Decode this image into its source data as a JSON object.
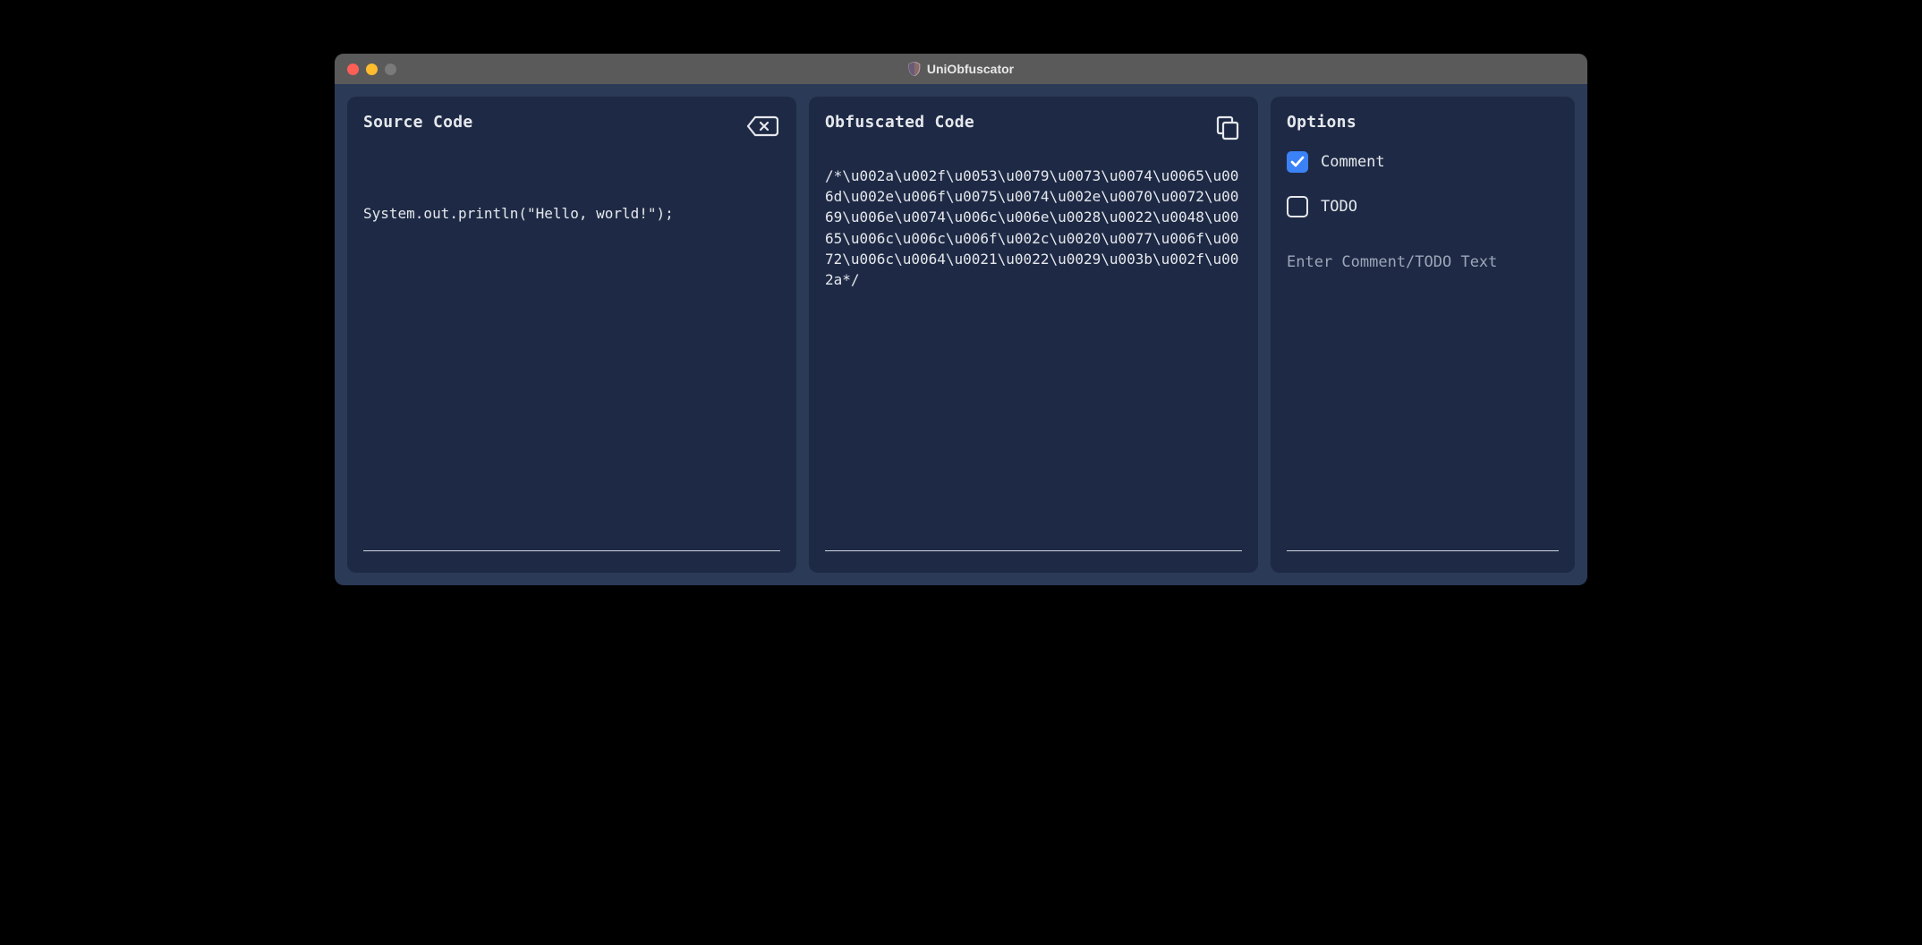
{
  "window": {
    "title": "UniObfuscator"
  },
  "panels": {
    "source": {
      "title": "Source Code",
      "content": "System.out.println(\"Hello, world!\");"
    },
    "obfuscated": {
      "title": "Obfuscated Code",
      "content": "/*\\u002a\\u002f\\u0053\\u0079\\u0073\\u0074\\u0065\\u006d\\u002e\\u006f\\u0075\\u0074\\u002e\\u0070\\u0072\\u0069\\u006e\\u0074\\u006c\\u006e\\u0028\\u0022\\u0048\\u0065\\u006c\\u006c\\u006f\\u002c\\u0020\\u0077\\u006f\\u0072\\u006c\\u0064\\u0021\\u0022\\u0029\\u003b\\u002f\\u002a*/"
    },
    "options": {
      "title": "Options",
      "items": [
        {
          "label": "Comment",
          "checked": true
        },
        {
          "label": "TODO",
          "checked": false
        }
      ],
      "input_placeholder": "Enter Comment/TODO Text"
    }
  },
  "colors": {
    "window_bg": "#2b3a56",
    "panel_bg": "#1e2a45",
    "titlebar_bg": "#5a5a5a",
    "text": "#e6e8ed",
    "accent": "#3b82f6"
  }
}
